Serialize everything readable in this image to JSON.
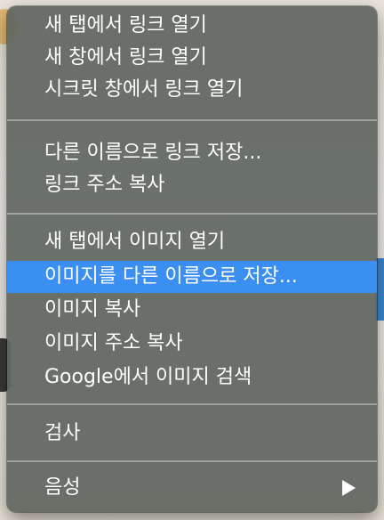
{
  "menu": {
    "groups": [
      {
        "items": [
          {
            "label": "새 탭에서 링크 열기"
          },
          {
            "label": "새 창에서 링크 열기"
          },
          {
            "label": "시크릿 창에서 링크 열기"
          }
        ]
      },
      {
        "items": [
          {
            "label": "다른 이름으로 링크 저장..."
          },
          {
            "label": "링크 주소 복사"
          }
        ]
      },
      {
        "items": [
          {
            "label": "새 탭에서 이미지 열기"
          },
          {
            "label": "이미지를 다른 이름으로 저장...",
            "highlighted": true
          },
          {
            "label": "이미지 복사"
          },
          {
            "label": "이미지 주소 복사"
          },
          {
            "label": "Google에서 이미지 검색"
          }
        ]
      },
      {
        "items": [
          {
            "label": "검사"
          }
        ]
      },
      {
        "items": [
          {
            "label": "음성",
            "submenu_icon": "chevron-right-icon"
          }
        ]
      }
    ]
  },
  "colors": {
    "menu_background": "#606660",
    "highlight": "#3b8ff0",
    "text": "#ffffff"
  }
}
